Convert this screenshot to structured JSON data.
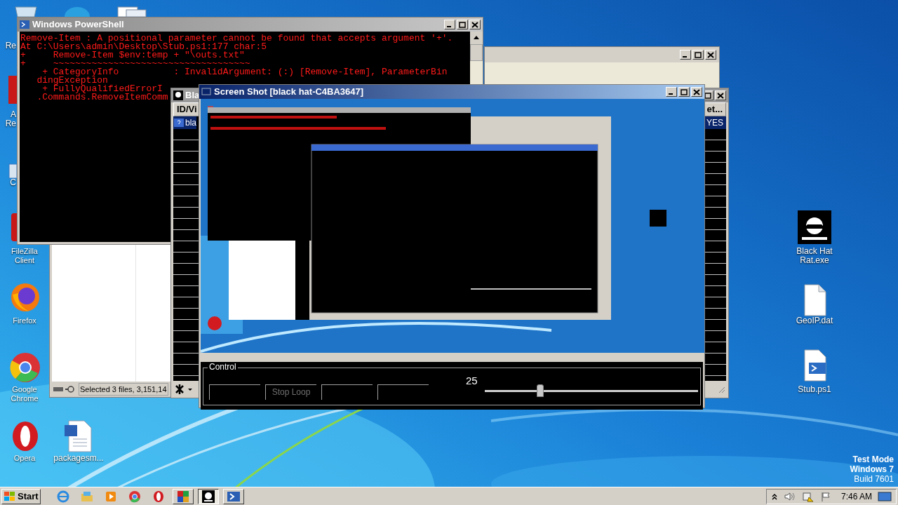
{
  "desktop": {
    "partial_labels": [
      {
        "label": "Re"
      },
      {
        "label": "A"
      },
      {
        "label": "Re"
      },
      {
        "label": "C"
      }
    ],
    "icons": [
      {
        "label": "FileZilla Client",
        "kind": "filezilla"
      },
      {
        "label": "Firefox",
        "kind": "firefox"
      },
      {
        "label": "Google Chrome",
        "kind": "chrome"
      },
      {
        "label": "Opera",
        "kind": "opera"
      },
      {
        "label": "packagesm...",
        "kind": "word"
      },
      {
        "label": "Black Hat Rat.exe",
        "kind": "blackhat"
      },
      {
        "label": "GeoIP.dat",
        "kind": "file"
      },
      {
        "label": "Stub.ps1",
        "kind": "script"
      }
    ],
    "mode_text": [
      "Test Mode",
      "Windows 7",
      "Build 7601"
    ]
  },
  "powershell": {
    "title": "Windows PowerShell",
    "lines": [
      "Remove-Item : A positional parameter cannot be found that accepts argument '+'.",
      "At C:\\Users\\admin\\Desktop\\Stub.ps1:177 char:5",
      "+     Remove-Item $env:temp + \"\\outs.txt\"",
      "+     ~~~~~~~~~~~~~~~~~~~~~~~~~~~~~~~~~~~~",
      "    + CategoryInfo          : InvalidArgument: (:) [Remove-Item], ParameterBin",
      "   dingException",
      "    + FullyQualifiedErrorI",
      "   .Commands.RemoveItemComm"
    ]
  },
  "explorer": {
    "status": "Selected 3 files, 3,151,14"
  },
  "rat_window": {
    "title": "Bla",
    "columns": [
      "ID/Vi",
      "et..."
    ],
    "rows": [
      {
        "cells": [
          "bla",
          "YES"
        ],
        "selected": true
      }
    ]
  },
  "screenshot_window": {
    "title": "Screen Shot [black hat-C4BA3647]",
    "control": {
      "label": "Control",
      "items": [
        {
          "kind": "field"
        },
        {
          "kind": "button",
          "label": "Stop Loop",
          "disabled": true
        },
        {
          "kind": "field"
        },
        {
          "kind": "field"
        }
      ],
      "value": "25",
      "level": 0.26
    }
  },
  "taskbar": {
    "start": "Start",
    "apps": [
      {
        "kind": "ie",
        "running": false,
        "selected": false
      },
      {
        "kind": "folder",
        "running": false,
        "selected": false
      },
      {
        "kind": "media",
        "running": false,
        "selected": false
      },
      {
        "kind": "chrome",
        "running": false,
        "selected": false
      },
      {
        "kind": "opera",
        "running": false,
        "selected": false
      },
      {
        "kind": "grid",
        "running": true,
        "selected": false
      },
      {
        "kind": "blackhat",
        "running": true,
        "selected": true
      },
      {
        "kind": "powershell",
        "running": true,
        "selected": false
      }
    ],
    "time": "7:46 AM"
  }
}
